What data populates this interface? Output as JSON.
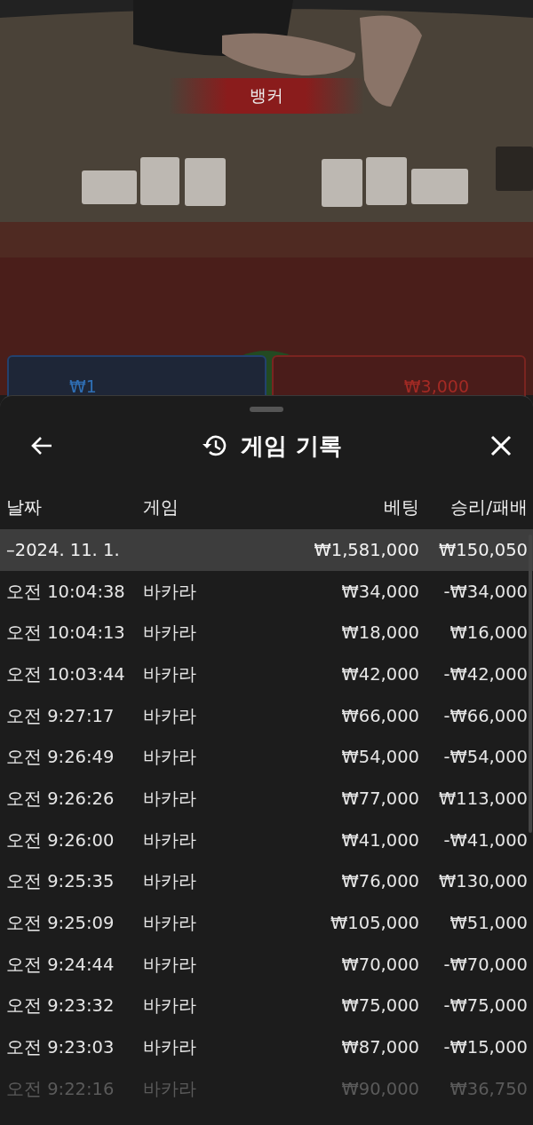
{
  "video": {
    "result_banner": "뱅커",
    "bets": [
      {
        "kind": "player",
        "amount": "₩1"
      },
      {
        "kind": "banker",
        "amount": "₩3,000"
      }
    ]
  },
  "sheet": {
    "title": "게임 기록",
    "columns": [
      "날짜",
      "게임",
      "베팅",
      "승리/패배"
    ],
    "rows": [
      {
        "kind": "group",
        "date": "–2024. 11. 1.",
        "game": "",
        "bet": "₩1,581,000",
        "result": "₩150,050",
        "faded": false
      },
      {
        "kind": "game",
        "date": "오전 10:04:38",
        "game": "바카라",
        "bet": "₩34,000",
        "result": "-₩34,000",
        "faded": false
      },
      {
        "kind": "game",
        "date": "오전 10:04:13",
        "game": "바카라",
        "bet": "₩18,000",
        "result": "₩16,000",
        "faded": false
      },
      {
        "kind": "game",
        "date": "오전 10:03:44",
        "game": "바카라",
        "bet": "₩42,000",
        "result": "-₩42,000",
        "faded": false
      },
      {
        "kind": "game",
        "date": "오전 9:27:17",
        "game": "바카라",
        "bet": "₩66,000",
        "result": "-₩66,000",
        "faded": false
      },
      {
        "kind": "game",
        "date": "오전 9:26:49",
        "game": "바카라",
        "bet": "₩54,000",
        "result": "-₩54,000",
        "faded": false
      },
      {
        "kind": "game",
        "date": "오전 9:26:26",
        "game": "바카라",
        "bet": "₩77,000",
        "result": "₩113,000",
        "faded": false
      },
      {
        "kind": "game",
        "date": "오전 9:26:00",
        "game": "바카라",
        "bet": "₩41,000",
        "result": "-₩41,000",
        "faded": false
      },
      {
        "kind": "game",
        "date": "오전 9:25:35",
        "game": "바카라",
        "bet": "₩76,000",
        "result": "₩130,000",
        "faded": false
      },
      {
        "kind": "game",
        "date": "오전 9:25:09",
        "game": "바카라",
        "bet": "₩105,000",
        "result": "₩51,000",
        "faded": false
      },
      {
        "kind": "game",
        "date": "오전 9:24:44",
        "game": "바카라",
        "bet": "₩70,000",
        "result": "-₩70,000",
        "faded": false
      },
      {
        "kind": "game",
        "date": "오전 9:23:32",
        "game": "바카라",
        "bet": "₩75,000",
        "result": "-₩75,000",
        "faded": false
      },
      {
        "kind": "game",
        "date": "오전 9:23:03",
        "game": "바카라",
        "bet": "₩87,000",
        "result": "-₩15,000",
        "faded": false
      },
      {
        "kind": "game",
        "date": "오전 9:22:16",
        "game": "바카라",
        "bet": "₩90,000",
        "result": "₩36,750",
        "faded": true
      }
    ]
  }
}
